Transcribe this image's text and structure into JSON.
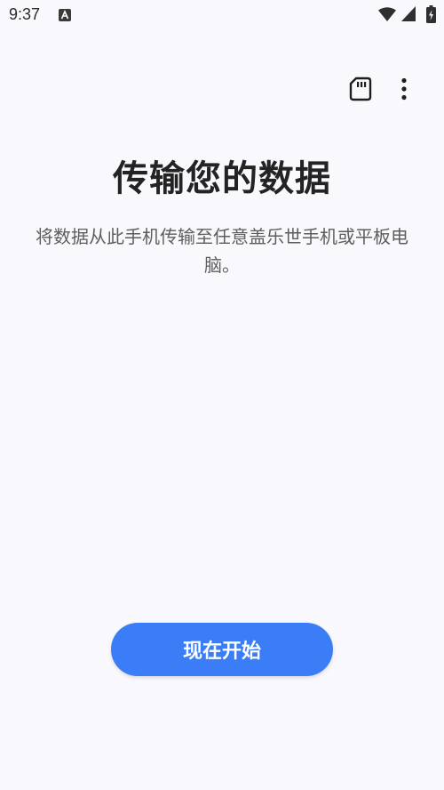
{
  "status_bar": {
    "time": "9:37",
    "icons": [
      "notification-a-icon",
      "wifi-icon",
      "cellular-signal-icon",
      "battery-charging-icon"
    ]
  },
  "toolbar": {
    "icons": [
      "sd-card-icon",
      "more-vert-icon"
    ]
  },
  "main": {
    "title": "传输您的数据",
    "description": "将数据从此手机传输至任意盖乐世手机或平板电脑。"
  },
  "actions": {
    "start_label": "现在开始"
  },
  "colors": {
    "accent": "#3a7df6",
    "background": "#f9f9fd",
    "title_text": "#232323",
    "body_text": "#5d5d5d"
  }
}
